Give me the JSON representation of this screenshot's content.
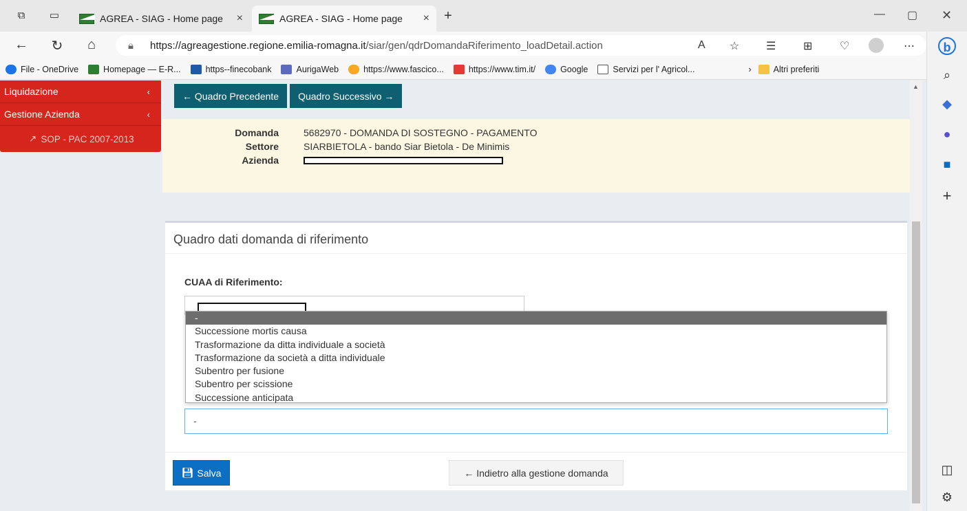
{
  "browser": {
    "tabs": [
      {
        "title": "AGREA - SIAG - Home page",
        "close": "×"
      },
      {
        "title": "AGREA - SIAG - Home page",
        "close": "×"
      }
    ],
    "new_tab": "+",
    "url_host": "https://agreagestione.regione.emilia-romagna.it",
    "url_path": "/siar/gen/qdrDomandaRiferimento_loadDetail.action",
    "bookmarks": [
      {
        "label": "File - OneDrive",
        "color": "#1a73e8"
      },
      {
        "label": "Homepage — E-R...",
        "color": "#2e7d32"
      },
      {
        "label": "https--finecobank",
        "color": "#1e5aa8"
      },
      {
        "label": "AurigaWeb",
        "color": "#5c6bc0"
      },
      {
        "label": "https://www.fascico...",
        "color": "#f9a825"
      },
      {
        "label": "https://www.tim.it/",
        "color": "#e53935"
      },
      {
        "label": "Google",
        "color": "#4285f4"
      },
      {
        "label": "Servizi per l' Agricol...",
        "color": "#ffffff"
      }
    ],
    "bookmarks_more": "Altri preferiti"
  },
  "leftnav": {
    "liquidazione": "Liquidazione",
    "gestione": "Gestione Azienda",
    "sop": "SOP - PAC 2007-2013",
    "chev": "‹"
  },
  "buttons": {
    "prev": "← Quadro Precedente",
    "next": "Quadro Successivo →",
    "salva": "Salva",
    "back": "← Indietro alla gestione domanda"
  },
  "info": {
    "domanda_label": "Domanda",
    "domanda_value": "5682970 - DOMANDA DI SOSTEGNO - PAGAMENTO",
    "settore_label": "Settore",
    "settore_value": "SIARBIETOLA - bando Siar Bietola - De Minimis",
    "azienda_label": "Azienda"
  },
  "panel": {
    "title": "Quadro dati domanda di riferimento",
    "cuaa_label": "CUAA di Riferimento:",
    "dropdown_options": [
      "-",
      "Successione mortis causa",
      "Trasformazione da ditta individuale a società",
      "Trasformazione da società a ditta individuale",
      "Subentro per fusione",
      "Subentro per scissione",
      "Successione anticipata"
    ],
    "selected_value": "-"
  }
}
